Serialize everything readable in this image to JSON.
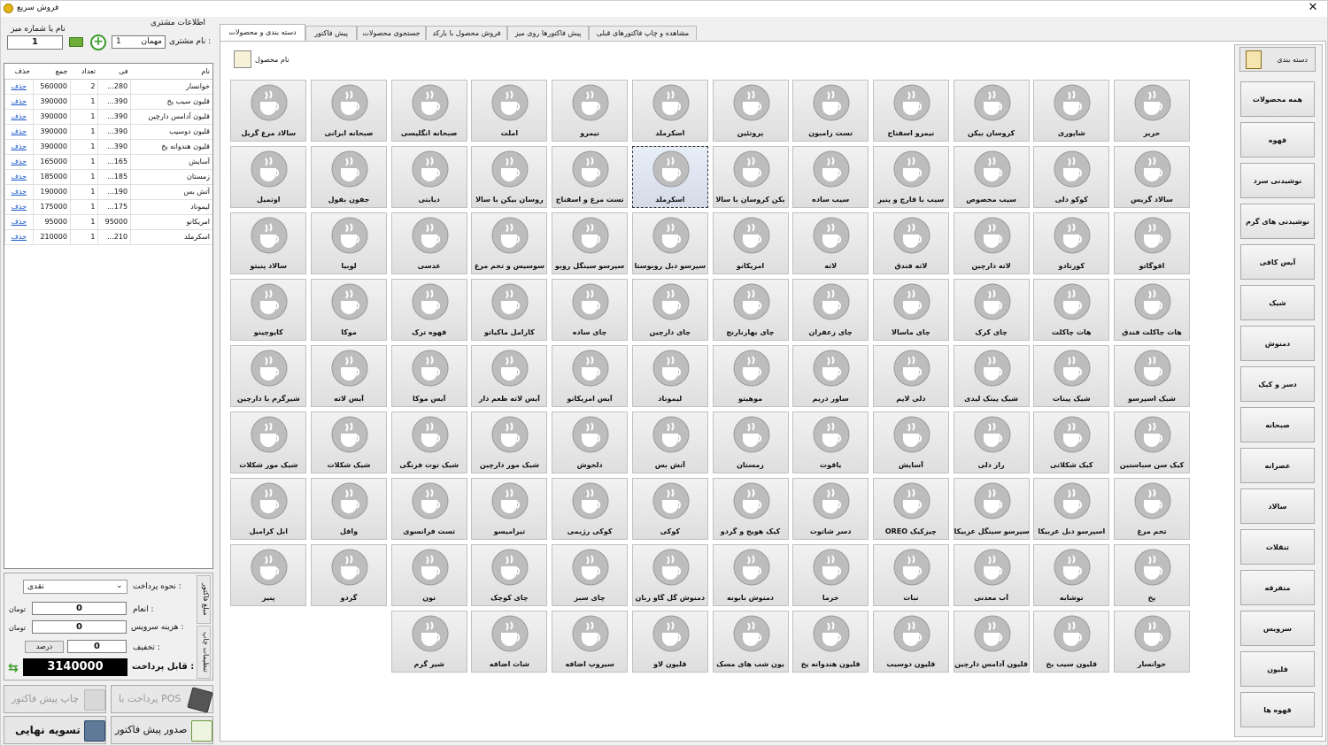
{
  "window": {
    "title": "فروش سریع"
  },
  "customer": {
    "section_label": "اطلاعات مشتری",
    "table_label": "نام یا شماره میز",
    "table_value": "1",
    "name_label": "نام مشتری :",
    "customer_number": "1",
    "customer_name": "مهمان"
  },
  "order_table": {
    "headers": {
      "name": "نام",
      "price": "فی",
      "qty": "تعداد",
      "total": "جمع",
      "delete": "حذف"
    },
    "rows": [
      {
        "name": "خوانسار",
        "price": "280...",
        "qty": "2",
        "total": "560000",
        "delete": "حذف"
      },
      {
        "name": "قلیون سیب یخ",
        "price": "390...",
        "qty": "1",
        "total": "390000",
        "delete": "حذف"
      },
      {
        "name": "قلیون آدامس دارچین",
        "price": "390...",
        "qty": "1",
        "total": "390000",
        "delete": "حذف"
      },
      {
        "name": "قلیون دوسیب",
        "price": "390...",
        "qty": "1",
        "total": "390000",
        "delete": "حذف"
      },
      {
        "name": "قلیون هندوانه یخ",
        "price": "390...",
        "qty": "1",
        "total": "390000",
        "delete": "حذف"
      },
      {
        "name": "آسایش",
        "price": "165...",
        "qty": "1",
        "total": "165000",
        "delete": "حذف"
      },
      {
        "name": "زمستان",
        "price": "185...",
        "qty": "1",
        "total": "185000",
        "delete": "حذف"
      },
      {
        "name": "آتش بس",
        "price": "190...",
        "qty": "1",
        "total": "190000",
        "delete": "حذف"
      },
      {
        "name": "لیموناد",
        "price": "175...",
        "qty": "1",
        "total": "175000",
        "delete": "حذف"
      },
      {
        "name": "امریکانو",
        "price": "95000",
        "qty": "1",
        "total": "95000",
        "delete": "حذف"
      },
      {
        "name": "اسکرملد",
        "price": "210...",
        "qty": "1",
        "total": "210000",
        "delete": "حذف"
      }
    ]
  },
  "payment": {
    "method_label": "نحوه پرداخت :",
    "method_value": "نقدی",
    "tip_label": "انعام :",
    "tip_value": "0",
    "service_label": "هزینه سرویس :",
    "service_value": "0",
    "discount_label": "تخفیف :",
    "discount_value": "0",
    "percent_button": "درصد",
    "unit": "تومان",
    "payable_label": "قابل پرداخت :",
    "payable_value": "3140000",
    "side_tab_1": "مبلغ فاکتور",
    "side_tab_2": "تنظیمات چاپ"
  },
  "actions": {
    "print_preinvoice": "چاپ پیش فاکتور",
    "pay_pos": "پرداخت با POS",
    "final_settle": "تسویه نهایی",
    "issue_preinvoice": "صدور پیش فاکتور"
  },
  "tabs": [
    "دسته بندی و محصولات",
    "پیش فاکتور",
    "جستجوی محصولات",
    "فروش محصول با بارکد",
    "پیش فاکتورها روی میز",
    "مشاهده و چاپ فاکتورهای قبلی"
  ],
  "product_header": "نام محصول",
  "products": [
    [
      "حریر",
      "شاپوری",
      "کروسان بیکن",
      "نیمرو اسفناج",
      "تست زامبون",
      "پروتئین",
      "اسکرملد",
      "نیمرو",
      "املت",
      "صبحانه انگلیسی",
      "صبحانه ایرانی",
      "سالاد مرغ گریل"
    ],
    [
      "سالاد گریس",
      "کوکو دلی",
      "سیب مخصوص",
      "سیب با قارچ و پنیر",
      "سیب ساده",
      "بکن کروسان با سالا",
      "اسکرملد",
      "تست مرغ و اسفناج",
      "روسان بیکن با سالا",
      "دیابتی",
      "جفون بفول",
      "اوتمیل"
    ],
    [
      "افوگاتو",
      "کورتادو",
      "لاته دارچین",
      "لاته فندق",
      "لاته",
      "امریکانو",
      "سپرسو دبل روبوستا",
      "سپرسو سینگل روبو",
      "سوسیس و تخم مرغ",
      "عدسی",
      "لوبیا",
      "سالاد پنیتو"
    ],
    [
      "هات چاکلت فندق",
      "هات چاکلت",
      "چای کرک",
      "چای ماسالا",
      "چای زعفران",
      "چای بهارنارنج",
      "چای دارچین",
      "چای ساده",
      "کارامل ماکیاتو",
      "قهوه ترک",
      "موکا",
      "کاپوچینو"
    ],
    [
      "شیک اسپرسو",
      "شیک پینات",
      "شیک پینک لیدی",
      "دلی لایم",
      "ساور دریم",
      "موهیتو",
      "لیموناد",
      "آیس امریکانو",
      "آیس لاته طعم دار",
      "آیس موکا",
      "آیس لاته",
      "شیرگرم با دارچین"
    ],
    [
      "کیک سن سباستین",
      "کیک شکلاتی",
      "راز دلی",
      "آسایش",
      "یاقوت",
      "زمستان",
      "آتش بس",
      "دلخوش",
      "شیک مور دارچین",
      "شیک توت فرنگی",
      "شیک شکلات",
      "شیک مور شکلات"
    ],
    [
      "تخم مرغ",
      "اسپرسو دبل عربیکا",
      "سپرسو سینگل عربیکا",
      "OREO چیزکیک",
      "دسر شاتوت",
      "کیک هویج و گردو",
      "کوکی",
      "کوکی رژیمی",
      "تیرامیسو",
      "تست فرانسوی",
      "وافل",
      "ابل کرامبل"
    ],
    [
      "یخ",
      "نوشابه",
      "آب معدنی",
      "نبات",
      "خرما",
      "دمنوش بابونه",
      "دمنوش گل گاو زبان",
      "چای سبز",
      "چای کوچک",
      "نون",
      "گردو",
      "پنیر"
    ],
    [
      "خوانسار",
      "قلیون سیب یخ",
      "قلیون آدامس دارچین",
      "قلیون دوسیب",
      "قلیون هندوانه یخ",
      "یون شب های مسک",
      "قلیون لاو",
      "سیروپ اضافه",
      "شات اضافه",
      "شیر گرم"
    ]
  ],
  "selected_product": "اسکرملد",
  "categories": {
    "header": "دسته بندی",
    "items": [
      "همه محصولات",
      "قهوه",
      "نوشیدنی سرد",
      "نوشیدنی های گرم",
      "آیس کافی",
      "شیک",
      "دمنوش",
      "دسر و کیک",
      "صبحانه",
      "عصرانه",
      "سالاد",
      "تنقلات",
      "متفرقه",
      "سرویس",
      "قلیون",
      "قهوه ها"
    ]
  },
  "colors": {
    "accent_green": "#3a9a2a",
    "link_blue": "#1a56c8",
    "total_bg": "#000000"
  }
}
